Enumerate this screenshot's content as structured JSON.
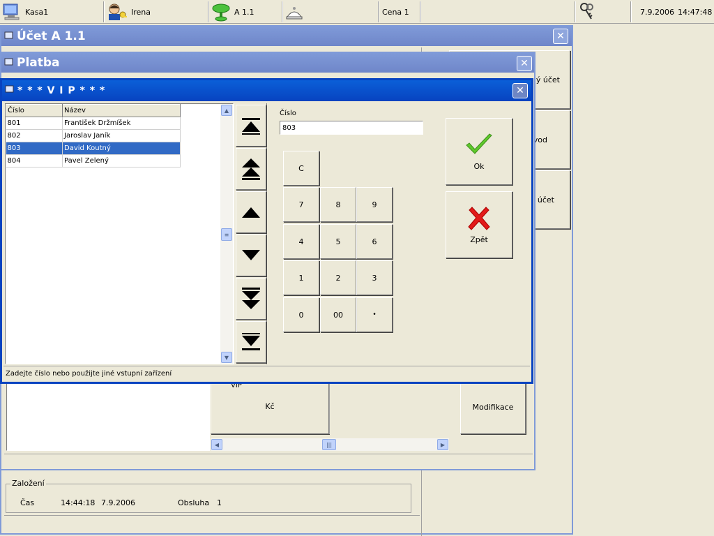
{
  "topbar": {
    "register": "Kasa1",
    "user": "Irena",
    "table": "A 1.1",
    "price_level": "Cena 1",
    "date": "7.9.2006",
    "time": "14:47:48"
  },
  "ucet_window": {
    "title": "Účet A 1.1",
    "right_buttons": [
      "ný účet",
      "vod",
      "účet"
    ],
    "modify_button": "Modifikace",
    "vip_label": "VIP",
    "currency": "Kč",
    "created_label": "Založení",
    "time_label": "Čas",
    "time_value": "14:44:18",
    "date_value": "7.9.2006",
    "staff_label": "Obsluha",
    "staff_value": "1"
  },
  "platba_window": {
    "title": "Platba"
  },
  "vip_window": {
    "title": "* * * V I P * * *",
    "columns": [
      "Číslo",
      "Název"
    ],
    "rows": [
      {
        "number": "801",
        "name": "František Držmíšek"
      },
      {
        "number": "802",
        "name": "Jaroslav Janík"
      },
      {
        "number": "803",
        "name": "David Koutný"
      },
      {
        "number": "804",
        "name": "Pavel Zelený"
      }
    ],
    "selected_index": 2,
    "number_label": "Číslo",
    "number_value": "803",
    "keypad": {
      "clear": "C",
      "k7": "7",
      "k8": "8",
      "k9": "9",
      "k4": "4",
      "k5": "5",
      "k6": "6",
      "k1": "1",
      "k2": "2",
      "k3": "3",
      "k0": "0",
      "k00": "00",
      "dot": "•"
    },
    "ok_label": "Ok",
    "back_label": "Zpět",
    "status": "Zadejte číslo nebo použijte jiné vstupní zařízení"
  },
  "colors": {
    "title_active": "#0843c0",
    "title_inactive": "#7f9ad8",
    "selection": "#316ac5",
    "ok_green": "#5fc92c",
    "cancel_red": "#e21a1a"
  }
}
